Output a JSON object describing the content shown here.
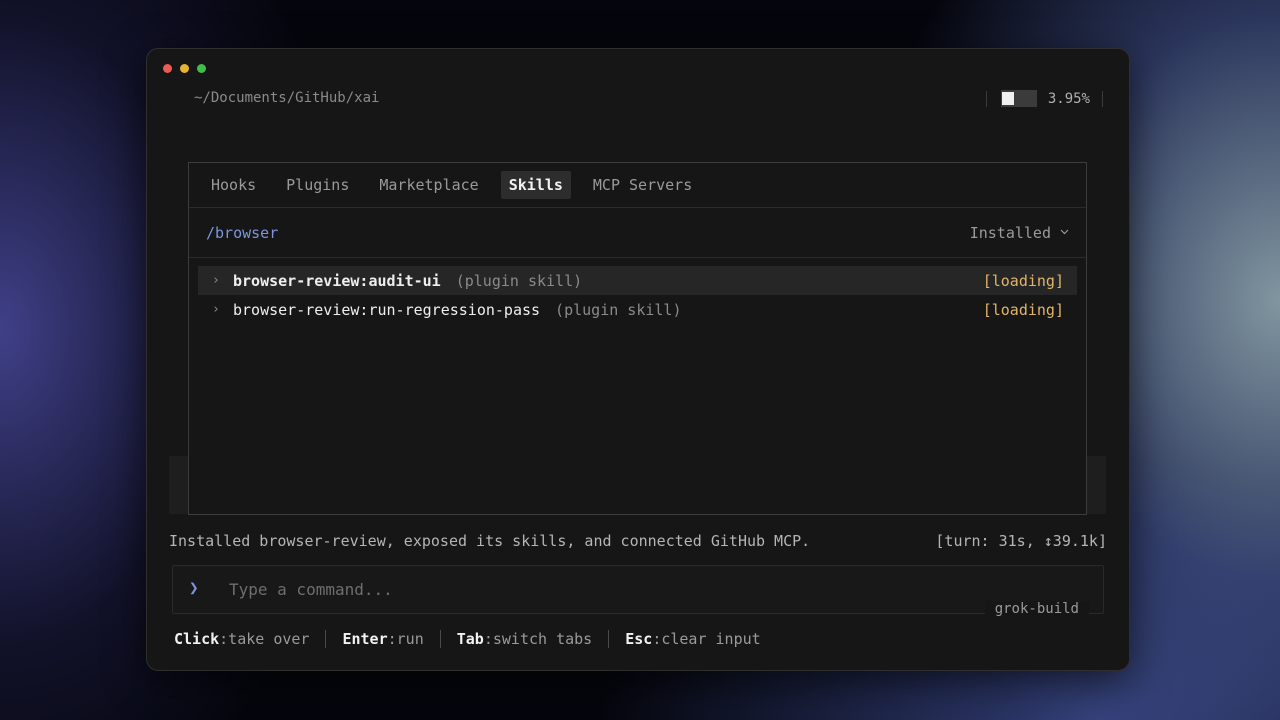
{
  "window": {
    "path": "~/Documents/GitHub/xai",
    "context_usage": {
      "fraction": 0.0395,
      "label": "3.95%"
    }
  },
  "panel": {
    "tabs": [
      {
        "label": "Hooks",
        "active": false
      },
      {
        "label": "Plugins",
        "active": false
      },
      {
        "label": "Marketplace",
        "active": false
      },
      {
        "label": "Skills",
        "active": true
      },
      {
        "label": "MCP Servers",
        "active": false
      }
    ],
    "filter": {
      "query": "/browser",
      "selected": "Installed",
      "chevron_icon": "chevron-down-icon"
    },
    "skills": [
      {
        "name": "browser-review:audit-ui",
        "kind": "(plugin skill)",
        "status": "[loading]",
        "selected": true
      },
      {
        "name": "browser-review:run-regression-pass",
        "kind": "(plugin skill)",
        "status": "[loading]",
        "selected": false
      }
    ]
  },
  "status": {
    "message": "Installed browser-review, exposed its skills, and connected GitHub MCP.",
    "turn": "[turn: 31s, ↕39.1k]"
  },
  "input": {
    "prompt_icon": "❯",
    "placeholder": "Type a command...",
    "model": "grok-build"
  },
  "hints": [
    {
      "key": "Click",
      "desc": ":take over"
    },
    {
      "key": "Enter",
      "desc": ":run"
    },
    {
      "key": "Tab",
      "desc": ":switch tabs"
    },
    {
      "key": "Esc",
      "desc": ":clear input"
    }
  ],
  "colors": {
    "accent": "#7e95dc",
    "loading": "#e2b56a",
    "window_bg": "#161616"
  }
}
